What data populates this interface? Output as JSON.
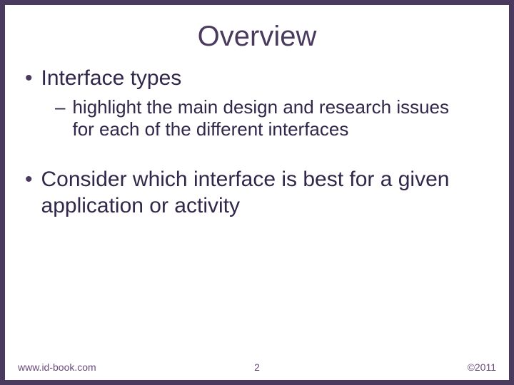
{
  "title": "Overview",
  "bullets": [
    {
      "text": "Interface types",
      "sub": [
        "highlight the main design and research issues for each of the different interfaces"
      ]
    },
    {
      "text": "Consider which interface is best for a given application or activity",
      "sub": []
    }
  ],
  "footer": {
    "left": "www.id-book.com",
    "center": "2",
    "right": "©2011"
  }
}
